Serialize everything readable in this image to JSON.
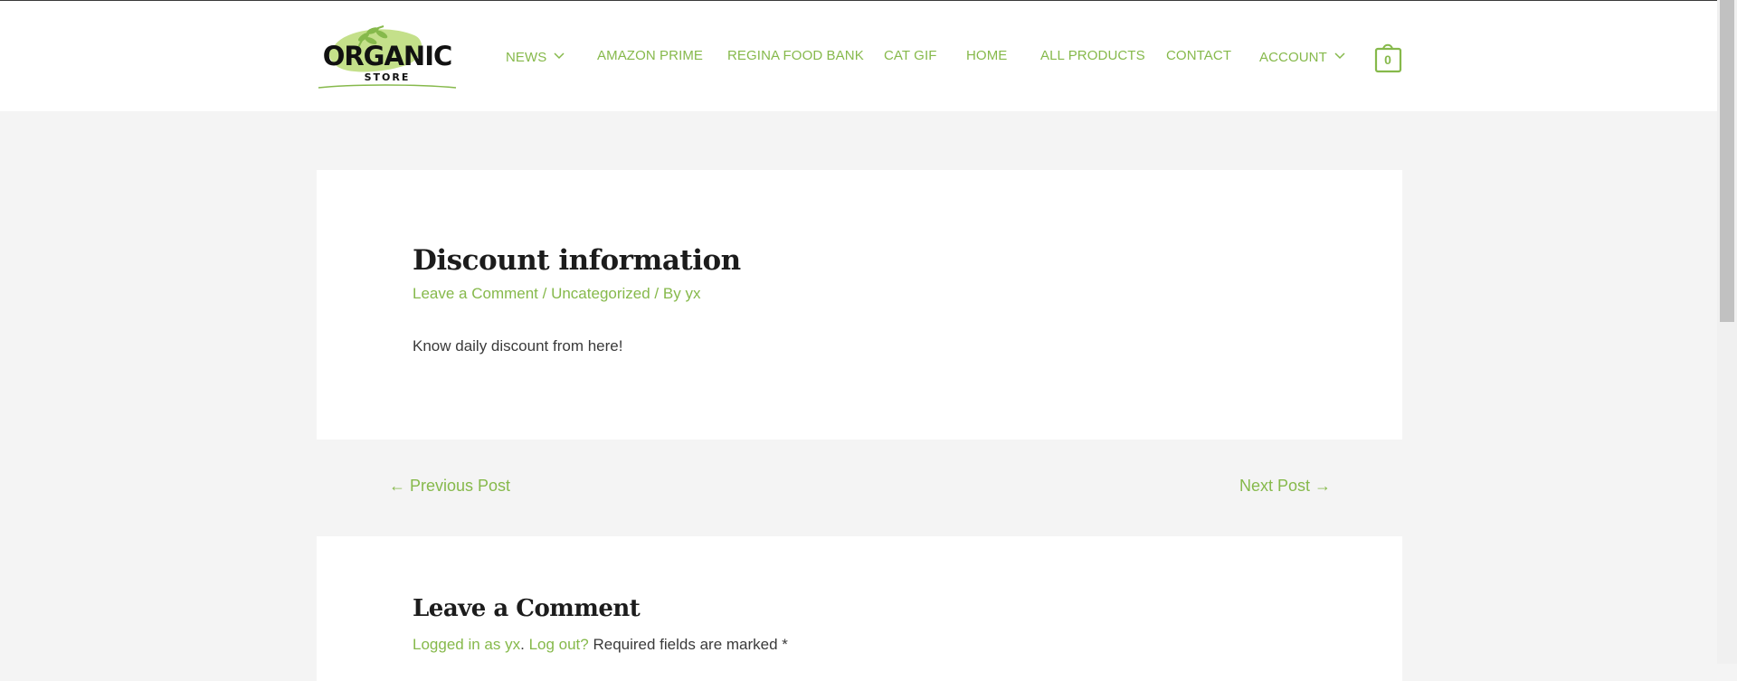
{
  "header": {
    "logo": {
      "line1": "ORGANIC",
      "line2": "STORE",
      "leaf_color": "#86b94b",
      "blob_color": "#c4e08a"
    },
    "nav": [
      {
        "label": "NEWS",
        "has_dropdown": true
      },
      {
        "label": "AMAZON PRIME"
      },
      {
        "label": "REGINA FOOD BANK"
      },
      {
        "label": "CAT GIF"
      },
      {
        "label": "HOME"
      },
      {
        "label": "ALL PRODUCTS"
      },
      {
        "label": "CONTACT"
      },
      {
        "label": "ACCOUNT",
        "has_dropdown": true
      }
    ],
    "cart": {
      "icon": "shopping-bag-icon",
      "count": "0"
    }
  },
  "post": {
    "title": "Discount information",
    "meta": {
      "comment_link": "Leave a Comment",
      "sep1": " / ",
      "category": "Uncategorized",
      "sep2": " / By ",
      "author": "yx"
    },
    "body": "Know daily discount from here!"
  },
  "post_navigation": {
    "previous": "← Previous Post",
    "next": "Next Post →"
  },
  "comments": {
    "title": "Leave a Comment",
    "logged_in_as": "Logged in as yx",
    "dot": ".",
    "logout": "Log out?",
    "required_note": " Required fields are marked *"
  },
  "colors": {
    "accent": "#86b94b",
    "background": "#f4f4f4",
    "card": "#ffffff",
    "heading": "#1c1c1c"
  }
}
